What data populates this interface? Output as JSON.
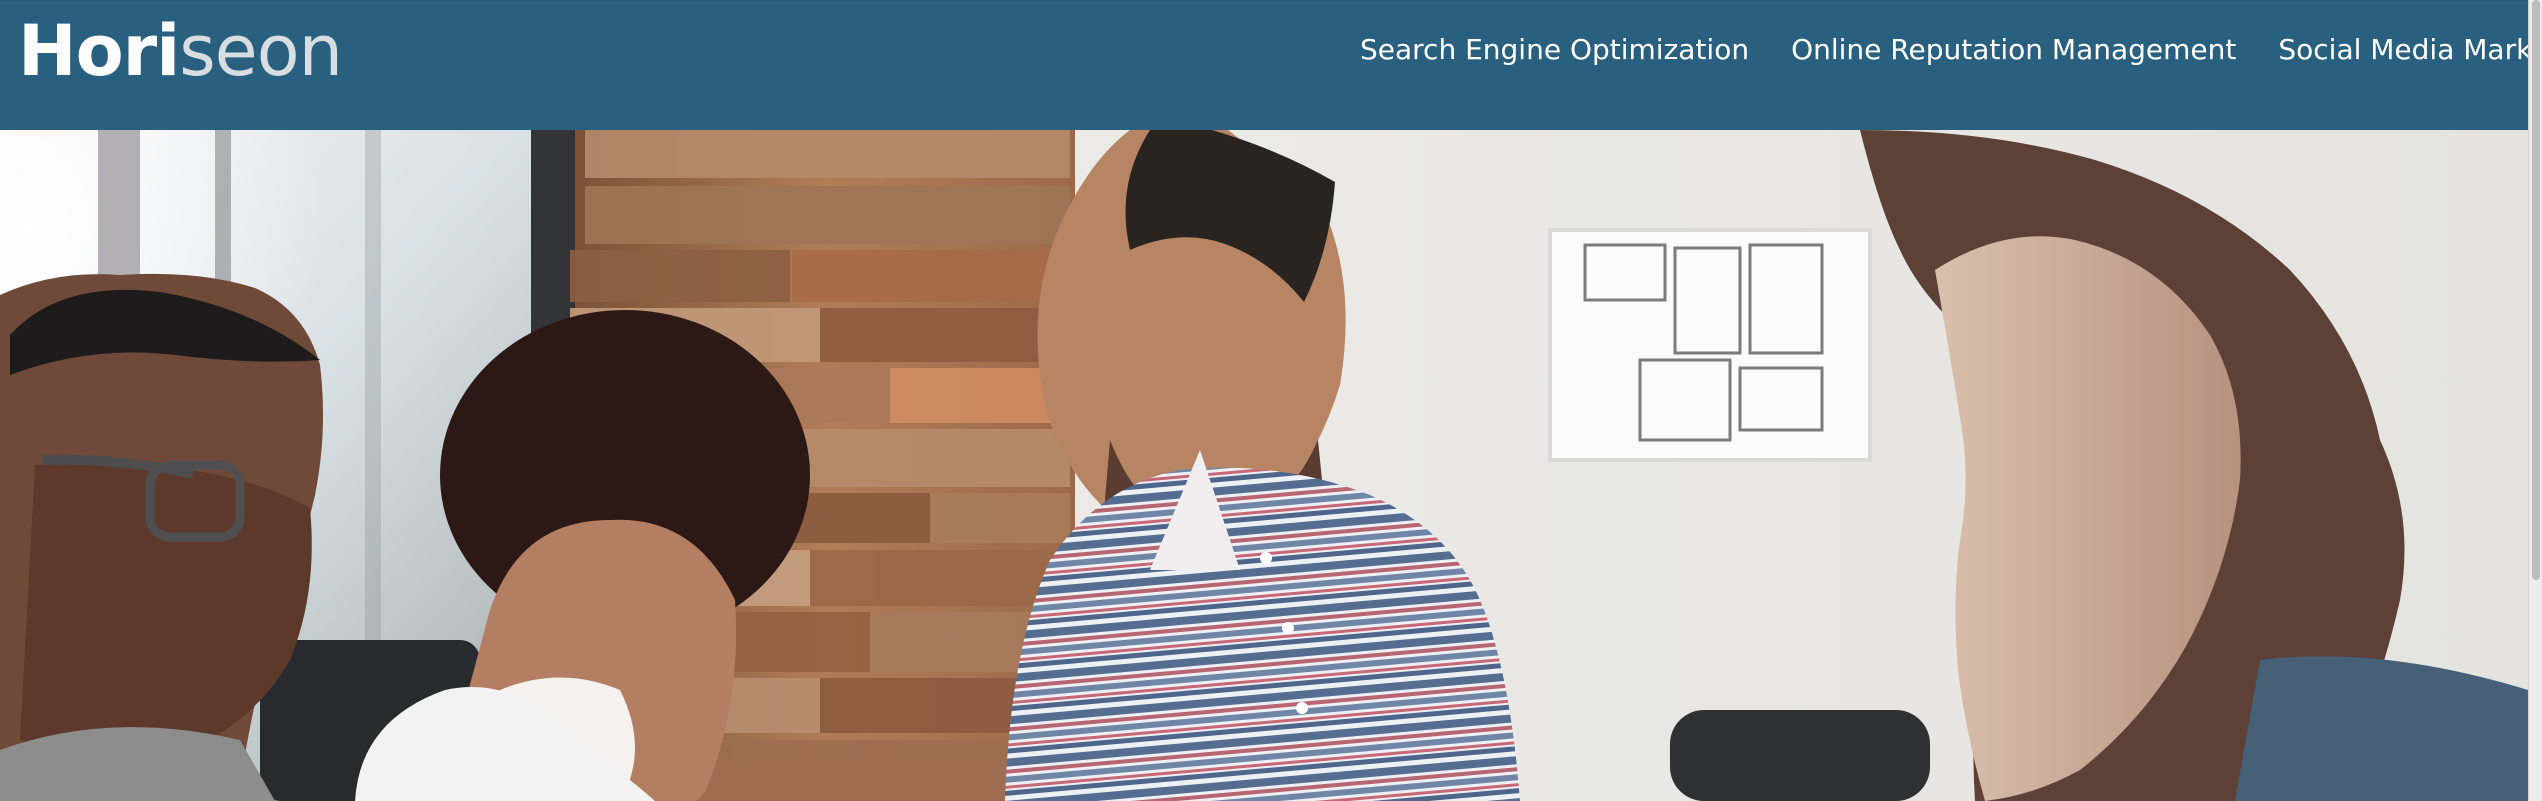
{
  "header": {
    "logo": {
      "part_a": "Hori",
      "part_b": "seon",
      "part_c": "n"
    },
    "nav": [
      {
        "label": "Search Engine Optimization"
      },
      {
        "label": "Online Reputation Management"
      },
      {
        "label": "Social Media Marketing"
      }
    ]
  },
  "colors": {
    "header_bg": "#2a607f",
    "header_text": "#ffffff",
    "logo_accent": "#d8dde2"
  },
  "icons": {
    "scrollbar": "scrollbar-icon"
  }
}
